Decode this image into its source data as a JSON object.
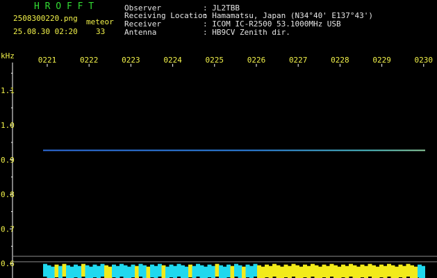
{
  "header": {
    "app_title": "H R O F F T",
    "filename": "2508300220.png",
    "timestamp": "25.08.30 02:20",
    "mode_label": "meteor",
    "meteor_count": "33",
    "info": [
      {
        "label": "Observer",
        "value": ": JL2TBB"
      },
      {
        "label": "Receiving Location",
        "value": ": Hamamatsu, Japan (N34°40' E137°43')"
      },
      {
        "label": "Receiver",
        "value": ": ICOM IC-R2500 53.1000MHz USB"
      },
      {
        "label": "Antenna",
        "value": ": HB9CV Zenith dir."
      }
    ]
  },
  "colors": {
    "header_text": "#f3f34a",
    "title_green": "#33dd33",
    "info_text": "#e6e6e6",
    "trace": "#2f7fe0",
    "noise_cyan": "#20d8ee",
    "noise_yellow": "#f2ea1a"
  },
  "chart_data": {
    "type": "heatmap",
    "ylabel": "kHz",
    "x_ticks": [
      "0221",
      "0222",
      "0223",
      "0224",
      "0225",
      "0226",
      "0227",
      "0228",
      "0229",
      "0230"
    ],
    "y_ticks": [
      "1.1",
      "1.0",
      "0.9",
      "0.8",
      "0.7",
      "0.6"
    ],
    "ylim": [
      0.58,
      1.19
    ],
    "trace_frequency_khz": 0.927,
    "reference_lines_khz": [
      0.621,
      0.605
    ],
    "noise_band_top_khz": 0.595,
    "noise_segment_count": 100,
    "meteor_echoes": []
  }
}
